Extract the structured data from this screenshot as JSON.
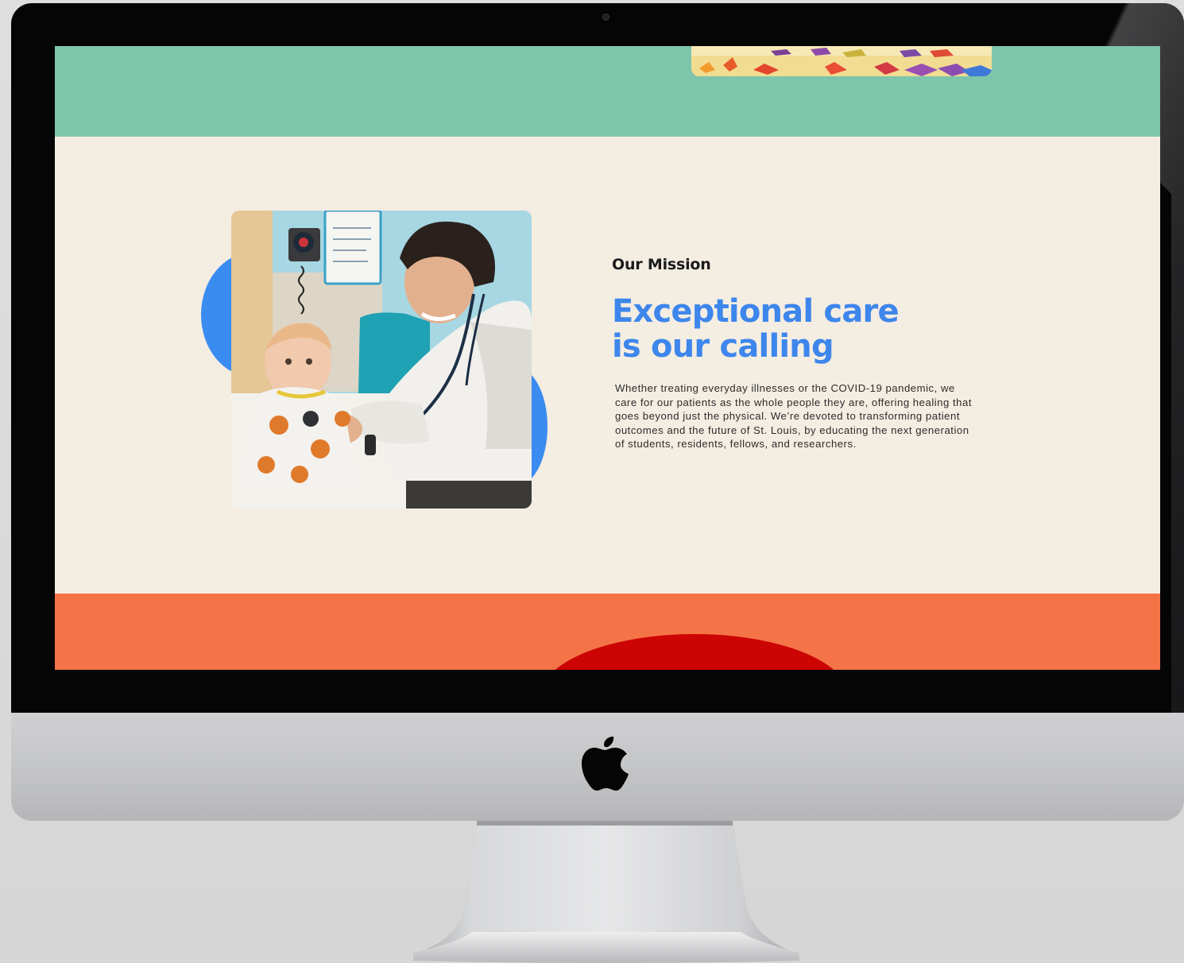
{
  "mission": {
    "eyebrow": "Our Mission",
    "headline_line1": "Exceptional care",
    "headline_line2": "is our calling",
    "body": "Whether treating everyday illnesses or the COVID-19 pandemic, we care for our patients as the whole people they are, offering healing that goes beyond just the physical. We’re devoted to transforming patient outcomes and the future of St. Louis, by educating the next generation of students, residents, fellows, and researchers."
  },
  "colors": {
    "green_band": "#7dc6ab",
    "cream_background": "#f4ede2",
    "headline_blue": "#3d86ec",
    "accent_blob_blue": "#3b8cf1",
    "orange_band": "#f57447",
    "red_accent": "#cc0404"
  },
  "icons": {
    "brand_logo": "apple-logo-icon"
  }
}
